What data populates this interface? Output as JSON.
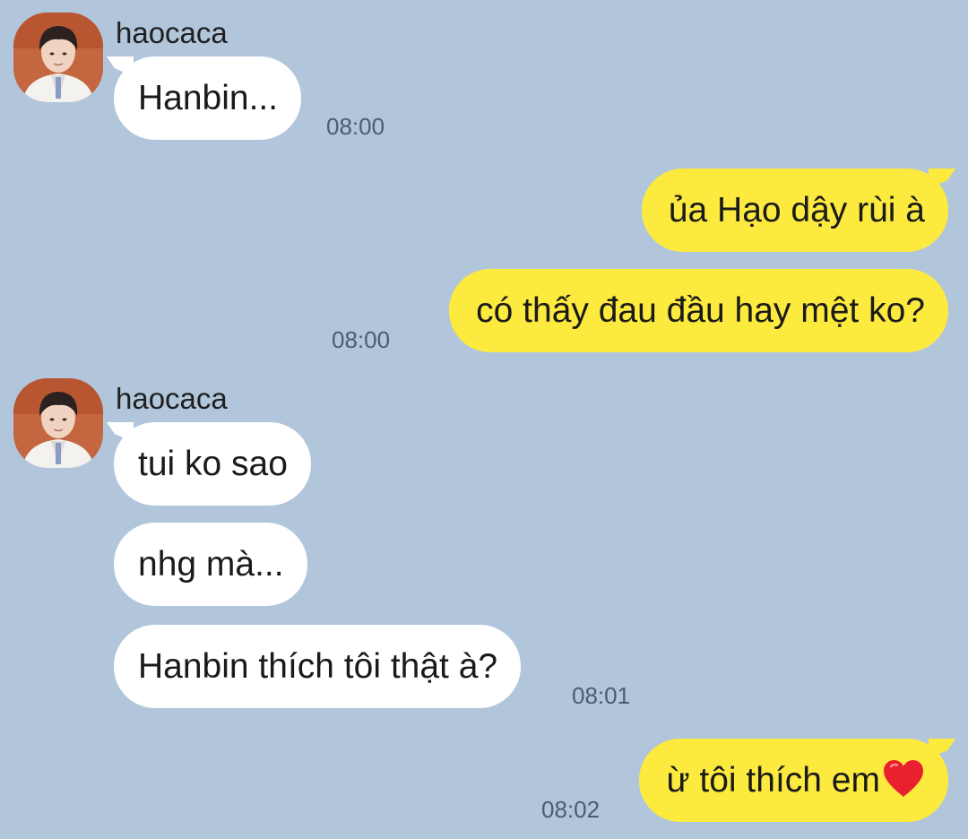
{
  "chat": {
    "contact_name": "haocaca",
    "messages": [
      {
        "from": "contact",
        "text": "Hanbin...",
        "time": "08:00"
      },
      {
        "from": "me",
        "text": "ủa Hạo dậy rùi à",
        "time": ""
      },
      {
        "from": "me",
        "text": "có thấy đau đầu hay mệt ko?",
        "time": "08:00"
      },
      {
        "from": "contact",
        "text": "tui ko sao",
        "time": ""
      },
      {
        "from": "contact",
        "text": "nhg mà...",
        "time": ""
      },
      {
        "from": "contact",
        "text": "Hanbin thích tôi thật à?",
        "time": "08:01"
      },
      {
        "from": "me",
        "text": "ừ tôi thích em",
        "emoji": "red-heart",
        "time": "08:02"
      }
    ]
  },
  "colors": {
    "background": "#b1c6db",
    "incoming_bubble": "#ffffff",
    "outgoing_bubble": "#fdea3e",
    "timestamp": "#4e5d6c"
  }
}
